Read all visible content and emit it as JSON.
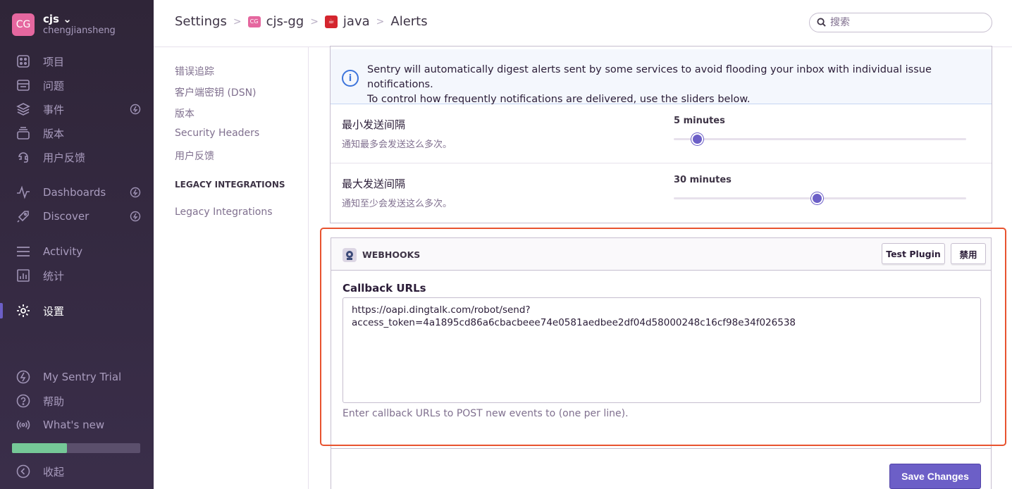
{
  "org": {
    "initials": "CG",
    "name": "cjs",
    "user": "chengjiansheng"
  },
  "nav": {
    "items": [
      {
        "label": "项目",
        "icon": "projects-icon"
      },
      {
        "label": "问题",
        "icon": "issues-icon"
      },
      {
        "label": "事件",
        "icon": "events-icon"
      },
      {
        "label": "版本",
        "icon": "releases-icon"
      },
      {
        "label": "用户反馈",
        "icon": "feedback-icon"
      },
      {
        "label": "Dashboards",
        "icon": "dashboards-icon"
      },
      {
        "label": "Discover",
        "icon": "discover-icon"
      },
      {
        "label": "Activity",
        "icon": "activity-icon"
      },
      {
        "label": "统计",
        "icon": "stats-icon"
      },
      {
        "label": "设置",
        "icon": "settings-icon"
      },
      {
        "label": "My Sentry Trial",
        "icon": "lightning-icon"
      },
      {
        "label": "帮助",
        "icon": "help-icon"
      },
      {
        "label": "What's new",
        "icon": "broadcast-icon"
      },
      {
        "label": "收起",
        "icon": "collapse-icon"
      }
    ],
    "trial_progress": 0.43
  },
  "header": {
    "crumbs": [
      "Settings",
      "cjs-gg",
      "java",
      "Alerts"
    ],
    "project_badge": "CG",
    "search_placeholder": "搜索"
  },
  "subnav": {
    "items": [
      "错误追踪",
      "客户端密钥 (DSN)",
      "版本",
      "Security Headers",
      "用户反馈"
    ],
    "section_title": "LEGACY INTEGRATIONS",
    "legacy_item": "Legacy Integrations"
  },
  "main": {
    "info_text_1": "Sentry will automatically digest alerts sent by some services to avoid flooding your inbox with individual issue notifications.",
    "info_text_2": "To control how frequently notifications are delivered, use the sliders below.",
    "min_delay": {
      "label": "最小发送间隔",
      "help": "通知最多会发送这么多次。",
      "value": "5 minutes",
      "position": 0.08
    },
    "max_delay": {
      "label": "最大发送间隔",
      "help": "通知至少会发送这么多次。",
      "value": "30 minutes",
      "position": 0.49
    },
    "webhooks": {
      "title": "WEBHOOKS",
      "test_button": "Test Plugin",
      "disable_button": "禁用",
      "field_label": "Callback URLs",
      "field_value": "https://oapi.dingtalk.com/robot/send?access_token=4a1895cd86a6cbacbeee74e0581aedbee2df04d58000248c16cf98e34f026538",
      "field_help": "Enter callback URLs to POST new events to (one per line)."
    },
    "save_button": "Save Changes"
  },
  "colors": {
    "accent": "#6c5fc7",
    "highlight": "#e8532f",
    "sidebar": "#2f2538"
  }
}
